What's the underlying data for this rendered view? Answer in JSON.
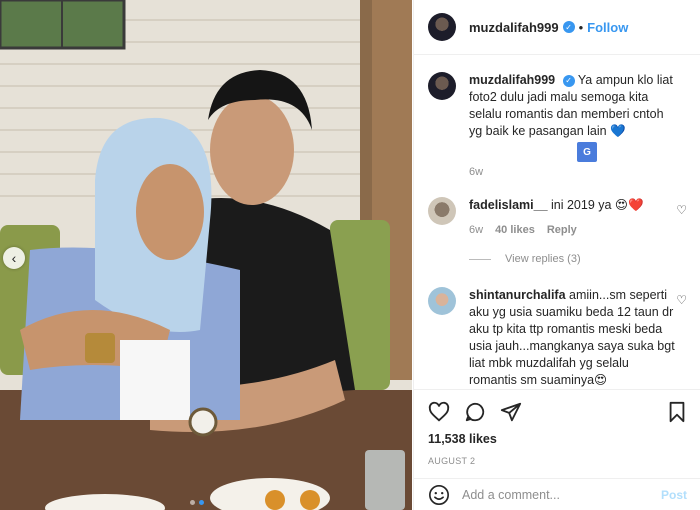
{
  "post": {
    "username": "muzdalifah999",
    "follow_label": "Follow",
    "separator": "•"
  },
  "caption": {
    "username": "muzdalifah999",
    "text": "Ya ampun klo liat foto2 dulu jadi malu semoga kita selalu romantis dan memberi cntoh yg baik ke pasangan lain 💙",
    "time": "6w",
    "translate_icon": "G"
  },
  "comments": [
    {
      "username": "fadelislami__",
      "text": "ini 2019 ya 😍❤️",
      "time": "6w",
      "likes": "40 likes",
      "reply_label": "Reply",
      "view_replies": "View replies (3)"
    },
    {
      "username": "shintanurchalifa",
      "text": "amiin...sm seperti aku yg usia suamiku beda 12 taun dr aku tp kita ttp romantis meski beda usia jauh...mangkanya saya suka bgt liat mbk muzdalifah yg selalu romantis sm suaminya😍"
    }
  ],
  "actions": {
    "likes": "11,538 likes",
    "date": "AUGUST 2"
  },
  "composer": {
    "placeholder": "Add a comment...",
    "post_label": "Post"
  },
  "icons": {
    "prev": "‹",
    "verified": "✓",
    "heart_small": "♡"
  },
  "colors": {
    "accent": "#3897f0",
    "post_disabled": "#b2dffc",
    "muted": "#8e8e8e"
  }
}
